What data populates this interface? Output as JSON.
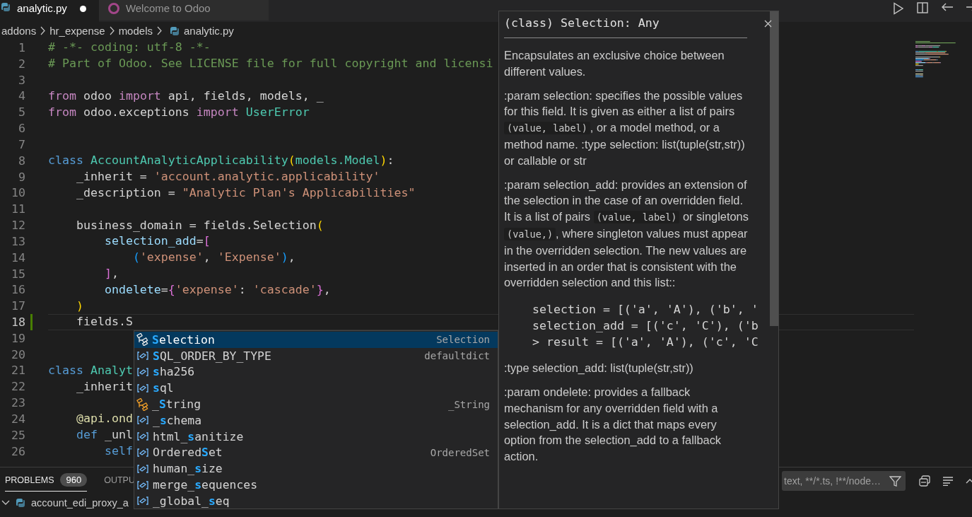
{
  "tabs": [
    {
      "label": "analytic.py",
      "kind": "source",
      "selected": true,
      "modified": true
    },
    {
      "label": "Welcome to Odoo",
      "kind": "welcome",
      "selected": false,
      "modified": false
    }
  ],
  "breadcrumb": [
    {
      "label": "addons",
      "kind": "folder"
    },
    {
      "label": "hr_expense",
      "kind": "folder"
    },
    {
      "label": "models",
      "kind": "folder"
    },
    {
      "label": "analytic.py",
      "kind": "file"
    }
  ],
  "editor": {
    "lines": [
      {
        "number": "1",
        "current": false,
        "changed": false,
        "tokens": [
          {
            "text": "# -*- coding: utf-8 -*-",
            "kind": "comment"
          }
        ]
      },
      {
        "number": "2",
        "current": false,
        "changed": false,
        "tokens": [
          {
            "text": "# Part of Odoo. See LICENSE file for full copyright and licensi",
            "kind": "comment"
          }
        ]
      },
      {
        "number": "3",
        "current": false,
        "changed": false
      },
      {
        "number": "4",
        "current": false,
        "changed": false,
        "tokens": [
          {
            "text": "from",
            "kind": "kw"
          },
          {
            "text": " odoo ",
            "kind": "plain"
          },
          {
            "text": "import",
            "kind": "kw"
          },
          {
            "text": " api, fields, models, _",
            "kind": "plain"
          }
        ]
      },
      {
        "number": "5",
        "current": false,
        "changed": false,
        "tokens": [
          {
            "text": "from",
            "kind": "kw"
          },
          {
            "text": " odoo.exceptions ",
            "kind": "plain"
          },
          {
            "text": "import",
            "kind": "kw"
          },
          {
            "text": " UserError",
            "kind": "cls"
          }
        ]
      },
      {
        "number": "6",
        "current": false,
        "changed": false
      },
      {
        "number": "7",
        "current": false,
        "changed": false
      },
      {
        "number": "8",
        "current": false,
        "changed": false,
        "tokens": [
          {
            "text": "class",
            "kind": "storage"
          },
          {
            "text": " AccountAnalyticApplicability",
            "kind": "cls"
          },
          {
            "text": "(",
            "kind": "b1"
          },
          {
            "text": "models.Model",
            "kind": "cls"
          },
          {
            "text": ")",
            "kind": "b1"
          },
          {
            "text": ":",
            "kind": "plain"
          }
        ]
      },
      {
        "number": "9",
        "current": false,
        "changed": false,
        "tokens": [
          {
            "text": "    _inherit = ",
            "kind": "plain"
          },
          {
            "text": "'account.analytic.applicability'",
            "kind": "str"
          }
        ]
      },
      {
        "number": "10",
        "current": false,
        "changed": false,
        "tokens": [
          {
            "text": "    _description = ",
            "kind": "plain"
          },
          {
            "text": "\"Analytic Plan's Applicabilities\"",
            "kind": "str"
          }
        ]
      },
      {
        "number": "11",
        "current": false,
        "changed": false
      },
      {
        "number": "12",
        "current": false,
        "changed": false,
        "tokens": [
          {
            "text": "    business_domain = fields.Selection",
            "kind": "plain"
          },
          {
            "text": "(",
            "kind": "b1"
          }
        ]
      },
      {
        "number": "13",
        "current": false,
        "changed": false,
        "tokens": [
          {
            "text": "        selection_add",
            "kind": "var"
          },
          {
            "text": "=",
            "kind": "plain"
          },
          {
            "text": "[",
            "kind": "b2"
          }
        ]
      },
      {
        "number": "14",
        "current": false,
        "changed": false,
        "tokens": [
          {
            "text": "            (",
            "kind": "b3"
          },
          {
            "text": "'expense'",
            "kind": "str"
          },
          {
            "text": ", ",
            "kind": "plain"
          },
          {
            "text": "'Expense'",
            "kind": "str"
          },
          {
            "text": ")",
            "kind": "b3"
          },
          {
            "text": ",",
            "kind": "plain"
          }
        ]
      },
      {
        "number": "15",
        "current": false,
        "changed": false,
        "tokens": [
          {
            "text": "        ]",
            "kind": "b2"
          },
          {
            "text": ",",
            "kind": "plain"
          }
        ]
      },
      {
        "number": "16",
        "current": false,
        "changed": false,
        "tokens": [
          {
            "text": "        ondelete",
            "kind": "var"
          },
          {
            "text": "=",
            "kind": "plain"
          },
          {
            "text": "{",
            "kind": "b2"
          },
          {
            "text": "'expense'",
            "kind": "str"
          },
          {
            "text": ": ",
            "kind": "plain"
          },
          {
            "text": "'cascade'",
            "kind": "str"
          },
          {
            "text": "}",
            "kind": "b2"
          },
          {
            "text": ",",
            "kind": "plain"
          }
        ]
      },
      {
        "number": "17",
        "current": false,
        "changed": false,
        "tokens": [
          {
            "text": "    )",
            "kind": "b1"
          }
        ]
      },
      {
        "number": "18",
        "current": true,
        "changed": true,
        "tokens": [
          {
            "text": "    fields.S",
            "kind": "plain"
          }
        ]
      },
      {
        "number": "19",
        "current": false,
        "changed": false
      },
      {
        "number": "20",
        "current": false,
        "changed": false
      },
      {
        "number": "21",
        "current": false,
        "changed": false,
        "tokens": [
          {
            "text": "class",
            "kind": "storage"
          },
          {
            "text": " Analyt",
            "kind": "cls"
          }
        ]
      },
      {
        "number": "22",
        "current": false,
        "changed": false,
        "tokens": [
          {
            "text": "    _inherit",
            "kind": "plain"
          }
        ]
      },
      {
        "number": "23",
        "current": false,
        "changed": false
      },
      {
        "number": "24",
        "current": false,
        "changed": false,
        "tokens": [
          {
            "text": "    @api.ond",
            "kind": "fn"
          }
        ]
      },
      {
        "number": "25",
        "current": false,
        "changed": false,
        "tokens": [
          {
            "text": "    def",
            "kind": "storage"
          },
          {
            "text": " _unl",
            "kind": "plain"
          }
        ]
      },
      {
        "number": "26",
        "current": false,
        "changed": false,
        "tokens": [
          {
            "text": "        self",
            "kind": "storage"
          }
        ]
      }
    ]
  },
  "suggestions": [
    {
      "label": "**S**election",
      "detail": "Selection",
      "kind": "class",
      "selected": true
    },
    {
      "label": "**S**QL_ORDER_BY_TYPE",
      "detail": "defaultdict",
      "kind": "variable",
      "selected": false
    },
    {
      "label": "**s**ha256",
      "kind": "variable",
      "selected": false
    },
    {
      "label": "**s**ql",
      "kind": "variable",
      "selected": false
    },
    {
      "label": "_**S**tring",
      "detail": "_String",
      "kind": "class",
      "selected": false
    },
    {
      "label": "_**s**chema",
      "kind": "variable",
      "selected": false
    },
    {
      "label": "html_**s**anitize",
      "kind": "variable",
      "selected": false
    },
    {
      "label": "Ordered**S**et",
      "detail": "OrderedSet",
      "kind": "variable",
      "selected": false
    },
    {
      "label": "human_**s**ize",
      "kind": "variable",
      "selected": false
    },
    {
      "label": "merge_**s**equences",
      "kind": "variable",
      "selected": false
    },
    {
      "label": "_global_**s**eq",
      "kind": "variable",
      "selected": false
    }
  ],
  "hover": {
    "title": "(class) Selection: Any",
    "blocks": [
      {
        "kind": "text",
        "parts": [
          {
            "t": "Encapsulates an exclusive choice between different values.",
            "code": false
          }
        ]
      },
      {
        "kind": "text",
        "parts": [
          {
            "t": ":param selection: specifies the possible values for this field. It is given as either a list of pairs ",
            "code": false
          },
          {
            "t": "(value, label)",
            "code": true
          },
          {
            "t": ", or a model method, or a method name. :type selection: list(tuple(str,str)) or callable or str",
            "code": false
          }
        ]
      },
      {
        "kind": "text",
        "parts": [
          {
            "t": ":param selection_add: provides an extension of the selection in the case of an overridden field. It is a list of pairs ",
            "code": false
          },
          {
            "t": "(value, label)",
            "code": true
          },
          {
            "t": " or singletons ",
            "code": false
          },
          {
            "t": "(value,)",
            "code": true
          },
          {
            "t": ", where singleton values must appear in the overridden selection. The new values are inserted in an order that is consistent with the overridden selection and this list::",
            "code": false
          }
        ]
      },
      {
        "kind": "codeblock",
        "lines": [
          "selection = [('a', 'A'), ('b', '",
          "selection_add = [('c', 'C'), ('b",
          "> result = [('a', 'A'), ('c', 'C"
        ]
      },
      {
        "kind": "text",
        "parts": [
          {
            "t": ":type selection_add: list(tuple(str,str))",
            "code": false
          }
        ]
      },
      {
        "kind": "text",
        "parts": [
          {
            "t": ":param ondelete: provides a fallback mechanism for any overridden field with a selection_add. It is a dict that maps every option from the selection_add to a fallback action.",
            "code": false
          }
        ]
      }
    ]
  },
  "panel": {
    "tabs": [
      {
        "label": "PROBLEMS",
        "badge": "960",
        "selected": true
      },
      {
        "label": "OUTPU",
        "selected": false
      }
    ],
    "filter": {
      "placeholder": "text, **/*.ts, !**/node…"
    },
    "tree": [
      {
        "label": "account_edi_proxy_a",
        "expanded": true
      }
    ]
  }
}
